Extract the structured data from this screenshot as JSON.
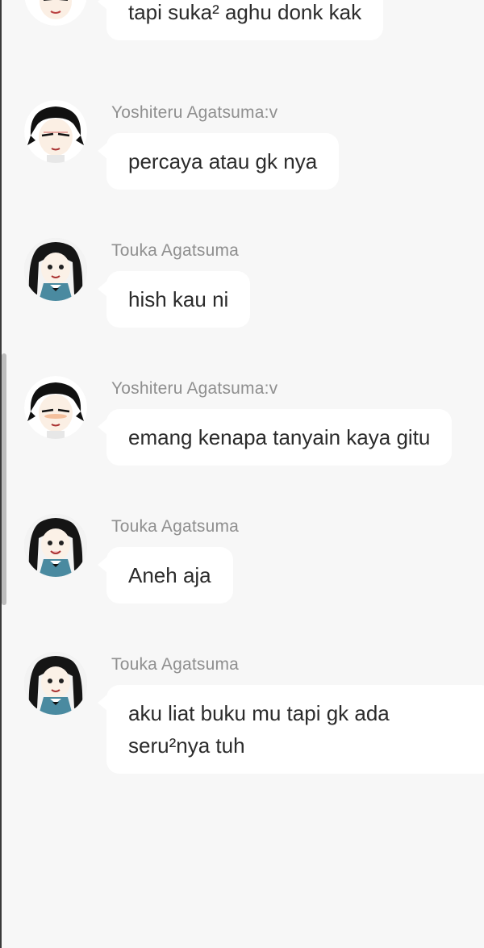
{
  "messages": [
    {
      "sender": "",
      "text": "tapi suka² aghu donk kak",
      "avatar": "yoshiteru-avatar"
    },
    {
      "sender": "Yoshiteru Agatsuma:v",
      "text": "percaya atau gk nya",
      "avatar": "yoshiteru-avatar"
    },
    {
      "sender": "Touka Agatsuma",
      "text": "hish kau ni",
      "avatar": "touka-avatar"
    },
    {
      "sender": "Yoshiteru Agatsuma:v",
      "text": "emang kenapa tanyain kaya gitu",
      "avatar": "yoshiteru-avatar"
    },
    {
      "sender": "Touka Agatsuma",
      "text": "Aneh aja",
      "avatar": "touka-avatar"
    },
    {
      "sender": "Touka Agatsuma",
      "text": "aku liat buku mu tapi gk ada seru²nya tuh",
      "avatar": "touka-avatar"
    }
  ],
  "colors": {
    "background": "#f7f7f7",
    "bubble": "#ffffff",
    "sender_text": "#8f8f8f",
    "message_text": "#2b2b2b"
  }
}
